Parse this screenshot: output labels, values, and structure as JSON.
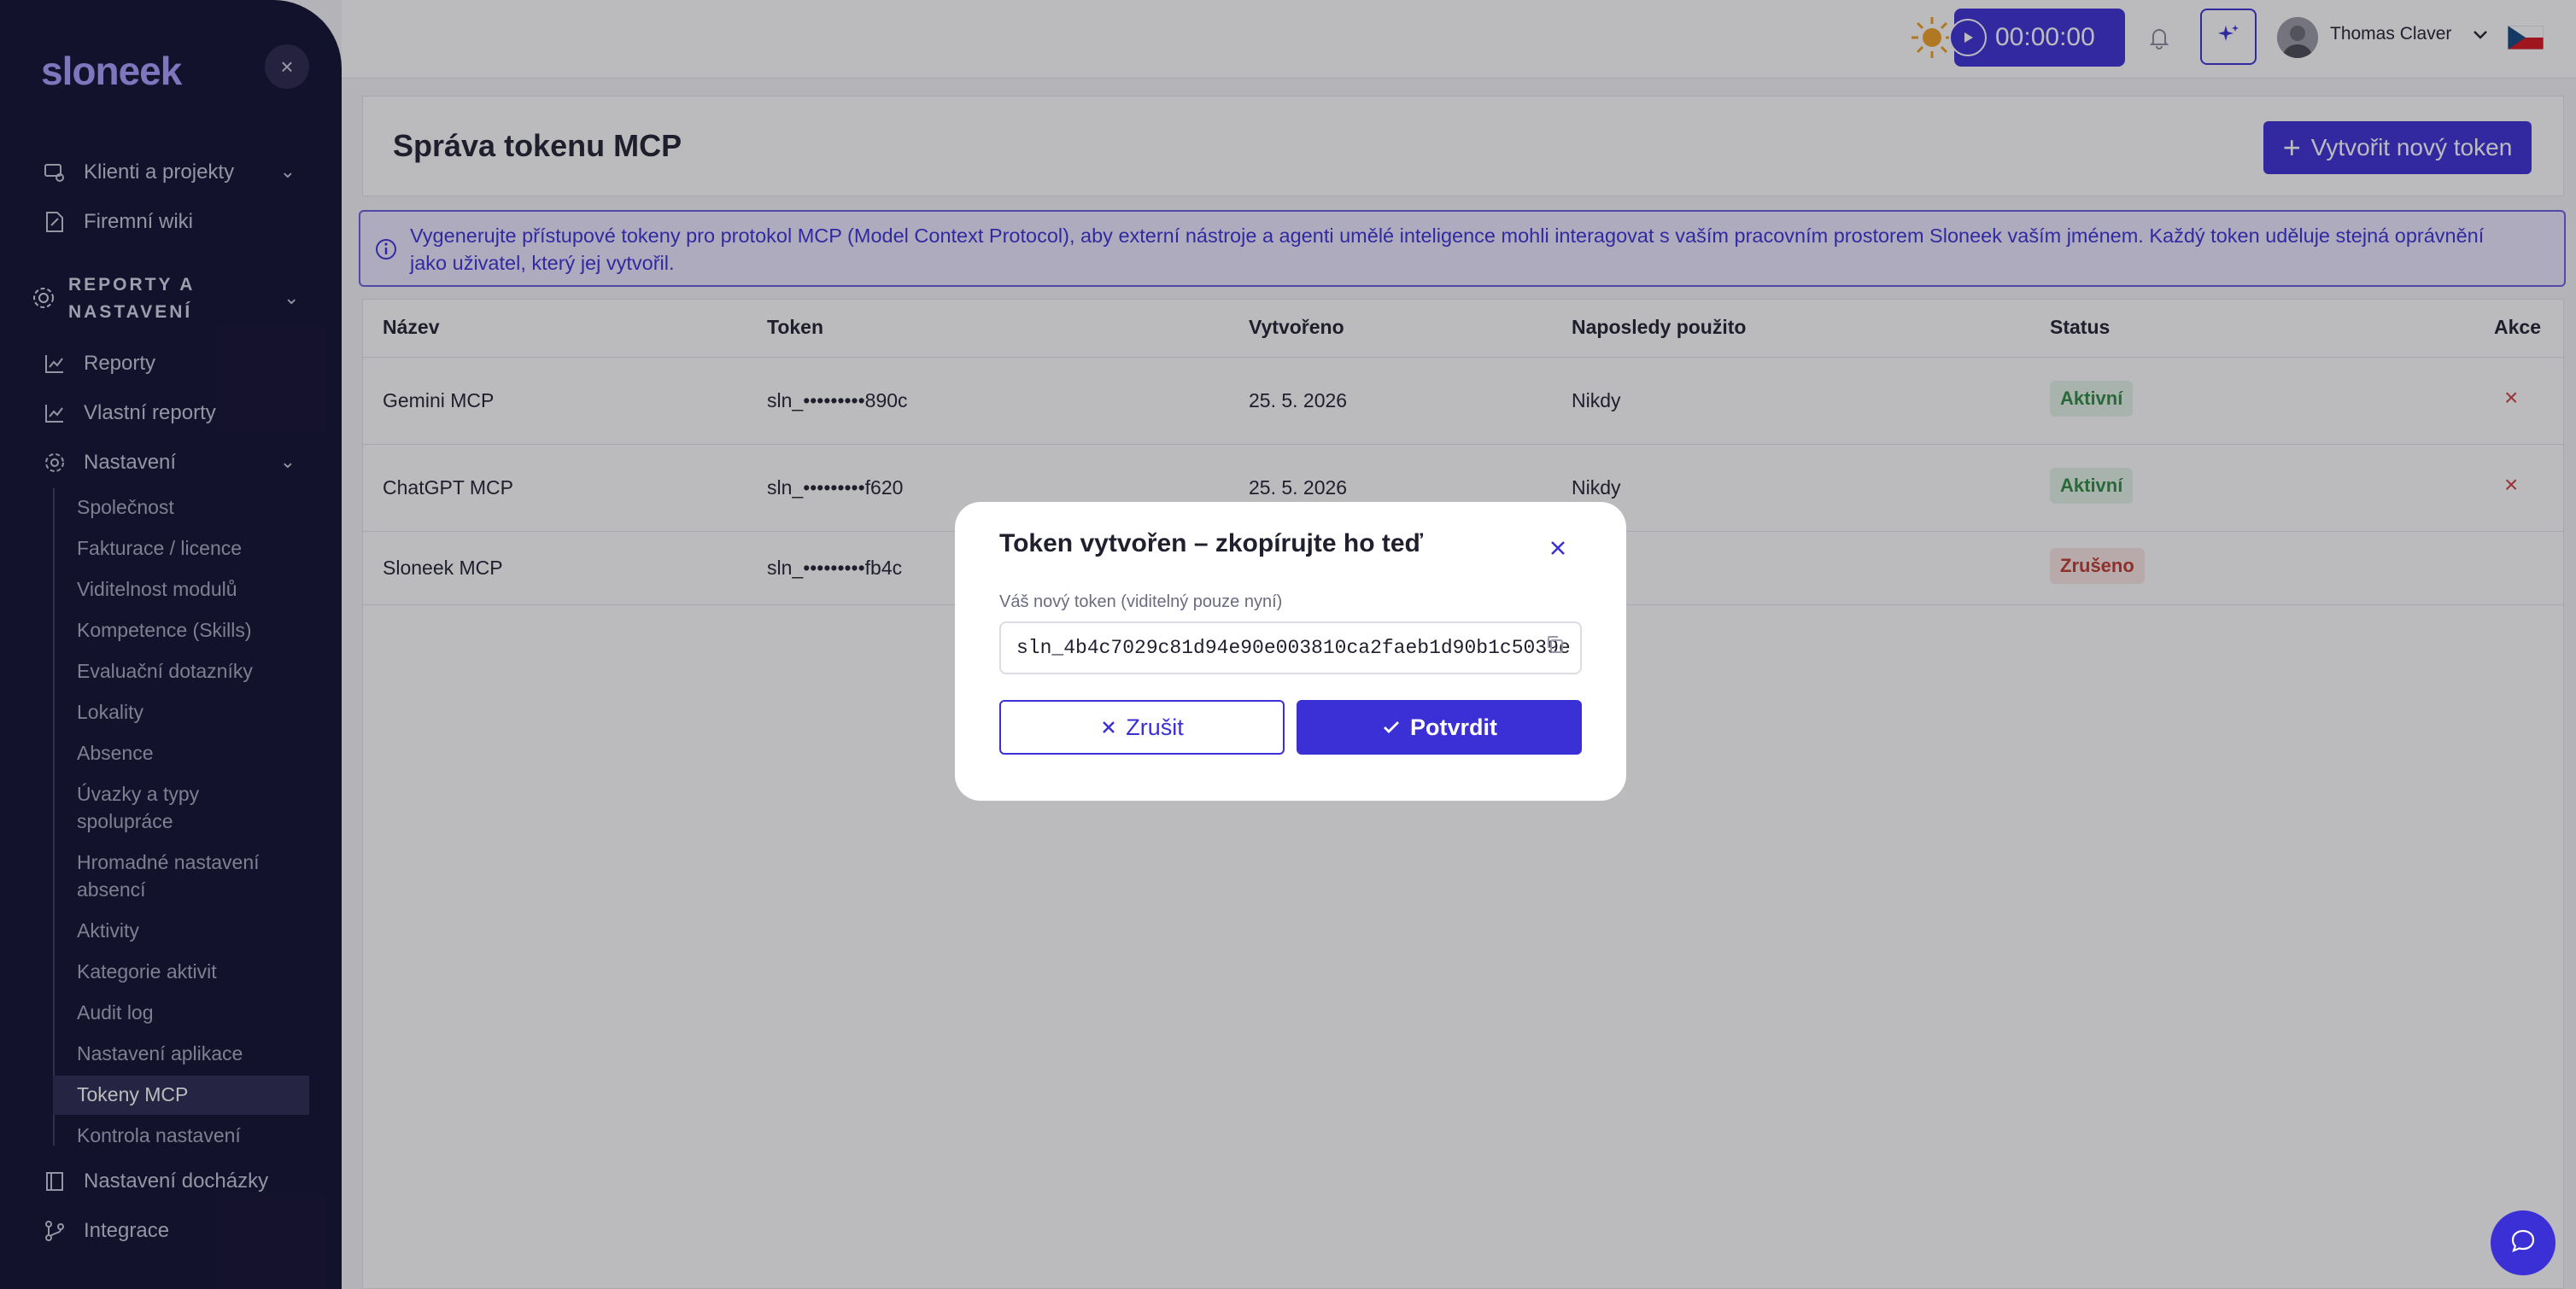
{
  "app": {
    "logo_main": "slon",
    "logo_accent": "eek"
  },
  "sidebar": {
    "top_items": [
      {
        "label": "Klienti a projekty",
        "icon": "clients-icon"
      },
      {
        "label": "Firemní wiki",
        "icon": "wiki-icon"
      }
    ],
    "group_label_line1": "REPORTY A",
    "group_label_line2": "NASTAVENÍ",
    "group_items": [
      {
        "label": "Reporty",
        "icon": "chart-icon"
      },
      {
        "label": "Vlastní reporty",
        "icon": "chart-icon"
      },
      {
        "label": "Nastavení",
        "icon": "gear-icon"
      }
    ],
    "settings_subitems": [
      "Společnost",
      "Fakturace / licence",
      "Viditelnost modulů",
      "Kompetence (Skills)",
      "Evaluační dotazníky",
      "Lokality",
      "Absence",
      "Úvazky a typy spolupráce",
      "Hromadné nastavení absencí",
      "Aktivity",
      "Kategorie aktivit",
      "Audit log",
      "Nastavení aplikace",
      "Tokeny MCP",
      "Kontrola nastavení"
    ],
    "active_subitem": "Tokeny MCP",
    "bottom_items": [
      {
        "label": "Nastavení docházky",
        "icon": "attendance-icon"
      },
      {
        "label": "Integrace",
        "icon": "integration-icon"
      }
    ]
  },
  "topbar": {
    "timer": "00:00:00",
    "user_name": "Thomas Claver"
  },
  "page": {
    "title": "Správa tokenu MCP",
    "new_token_button": "Vytvořit nový token",
    "info_line1": "Vygenerujte přístupové tokeny pro protokol MCP (Model Context Protocol), aby externí nástroje a agenti umělé inteligence mohli interagovat s vaším pracovním prostorem Sloneek vaším jménem. Každý token uděluje stejná oprávnění",
    "info_line2": "jako uživatel, který jej vytvořil."
  },
  "table": {
    "headers": {
      "name": "Název",
      "token": "Token",
      "created": "Vytvořeno",
      "last_used": "Naposledy použito",
      "status": "Status",
      "actions": "Akce"
    },
    "rows": [
      {
        "name": "Gemini MCP",
        "token": "sln_•••••••••890c",
        "created": "25. 5. 2026",
        "last_used": "Nikdy",
        "status": "Aktivní"
      },
      {
        "name": "ChatGPT MCP",
        "token": "sln_•••••••••f620",
        "created": "25. 5. 2026",
        "last_used": "Nikdy",
        "status": "Aktivní"
      },
      {
        "name": "Sloneek MCP",
        "token": "sln_•••••••••fb4c",
        "created": "",
        "last_used": "",
        "status": "Zrušeno"
      }
    ]
  },
  "modal": {
    "title": "Token vytvořen – zkopírujte ho teď",
    "label": "Váš nový token (viditelný pouze nyní)",
    "token_value": "sln_4b4c7029c81d94e90e003810ca2faeb1d90b1c5039e",
    "cancel_label": "Zrušit",
    "confirm_label": "Potvrdit"
  },
  "colors": {
    "primary": "#3b2fd6",
    "sidebar_bg": "#0f0d2e",
    "active_status": "#2f8a3e",
    "revoked_status": "#c0392b"
  }
}
